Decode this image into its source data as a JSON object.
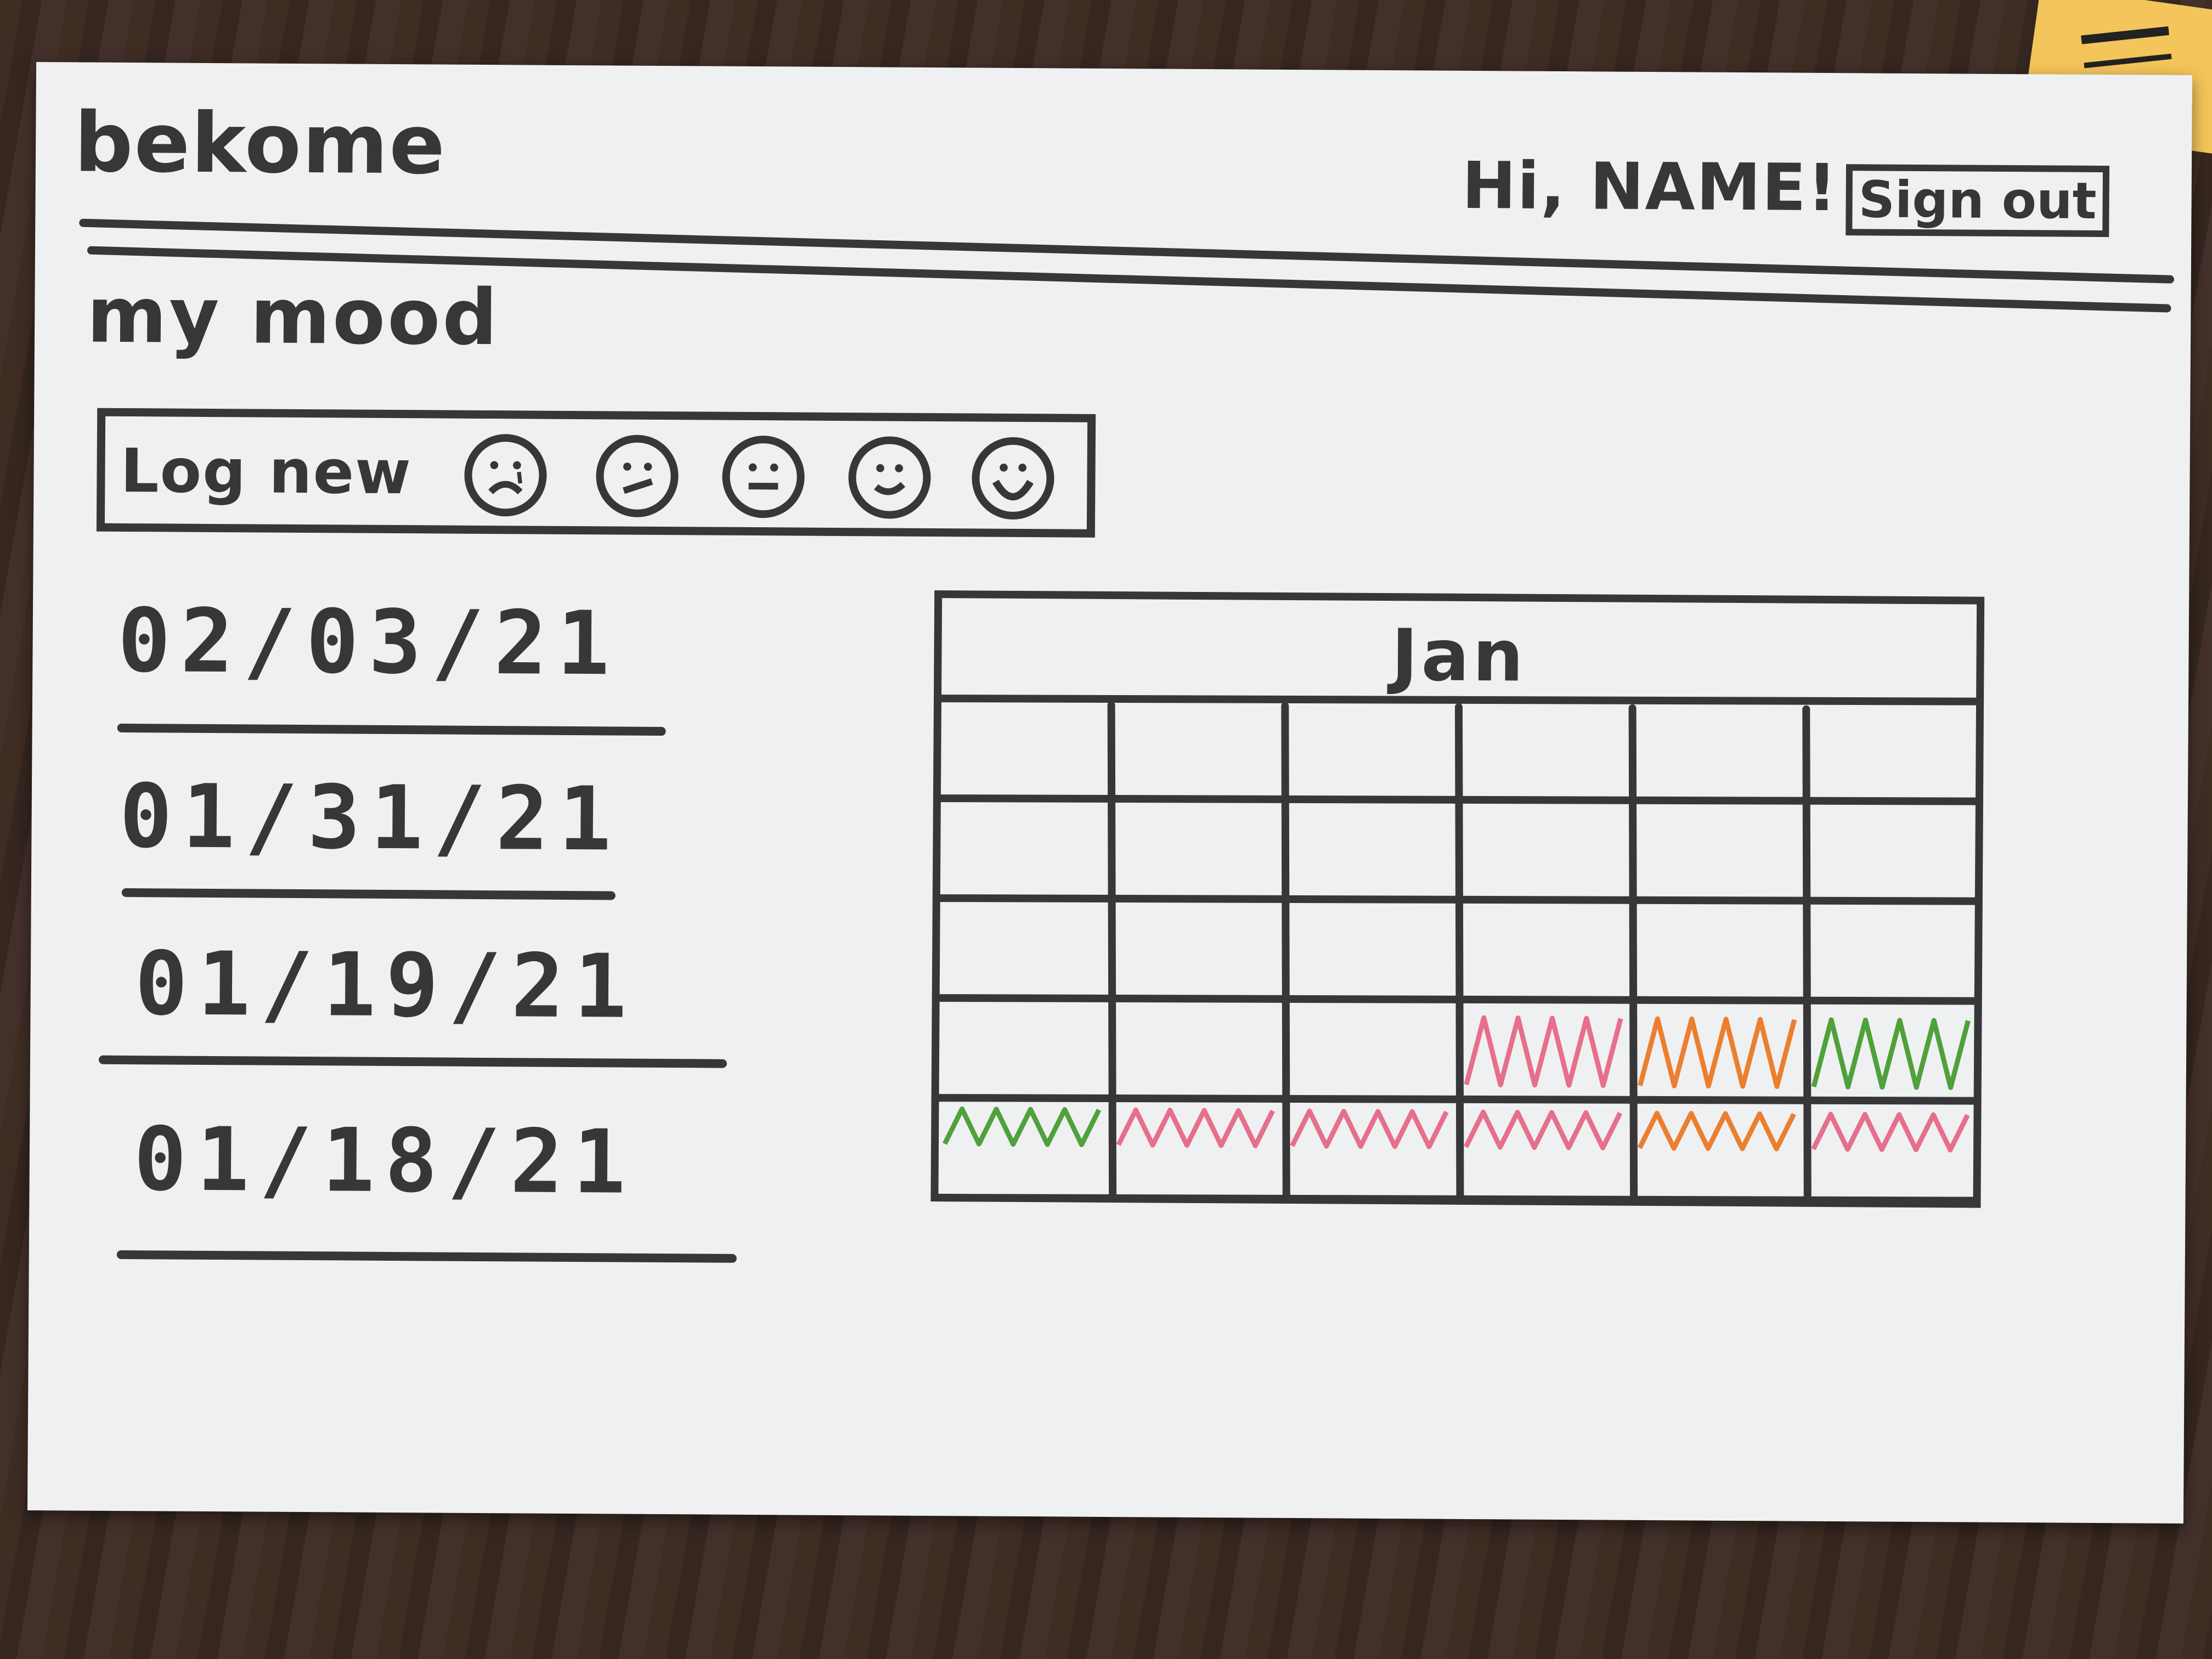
{
  "header": {
    "brand": "bekome",
    "greeting": "Hi, NAME!",
    "sign_out_label": "Sign out"
  },
  "mood_section": {
    "title": "my mood",
    "log_new_label": "Log new",
    "mood_options": [
      {
        "icon": "very-sad-face-icon"
      },
      {
        "icon": "sad-face-icon"
      },
      {
        "icon": "neutral-face-icon"
      },
      {
        "icon": "happy-face-icon"
      },
      {
        "icon": "very-happy-face-icon"
      }
    ]
  },
  "entries": [
    {
      "date": "02/03/21"
    },
    {
      "date": "01/31/21"
    },
    {
      "date": "01/19/21"
    },
    {
      "date": "01/18/21"
    }
  ],
  "calendar": {
    "month": "Jan",
    "columns": 6,
    "rows": 5,
    "colored_cells": [
      {
        "row": 3,
        "col": 3,
        "color": "#e66f8c"
      },
      {
        "row": 3,
        "col": 4,
        "color": "#ec7f2f"
      },
      {
        "row": 3,
        "col": 5,
        "color": "#4fa13a"
      },
      {
        "row": 4,
        "col": 0,
        "color": "#4fa13a"
      },
      {
        "row": 4,
        "col": 1,
        "color": "#e66f8c"
      },
      {
        "row": 4,
        "col": 2,
        "color": "#e66f8c"
      },
      {
        "row": 4,
        "col": 3,
        "color": "#e66f8c"
      },
      {
        "row": 4,
        "col": 4,
        "color": "#ec7f2f"
      },
      {
        "row": 4,
        "col": 5,
        "color": "#e66f8c"
      }
    ]
  },
  "colors": {
    "ink": "#373739",
    "paper": "#eff0f2",
    "green": "#4fa13a",
    "orange": "#ec7f2f",
    "pink": "#e66f8c"
  }
}
